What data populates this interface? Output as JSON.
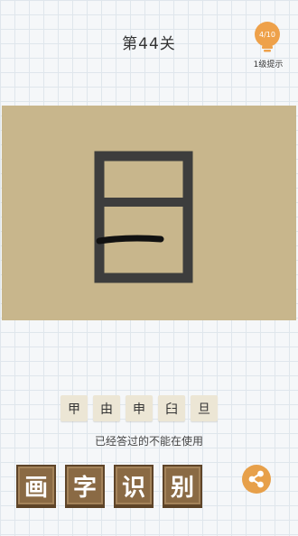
{
  "level": {
    "title": "第44关"
  },
  "hint": {
    "count": "4/10",
    "label": "1级提示"
  },
  "canvas": {
    "background_color": "#c8b68c",
    "stroke_color": "#3d3d3d",
    "scribble_color": "#111111"
  },
  "choices": [
    "甲",
    "由",
    "申",
    "臼",
    "旦"
  ],
  "notice": "已经答过的不能在使用",
  "app_title": [
    "画",
    "字",
    "识",
    "别"
  ],
  "share": {
    "icon": "share-icon",
    "color": "#e7a04a"
  },
  "icons": {
    "hint": "lightbulb-icon"
  }
}
